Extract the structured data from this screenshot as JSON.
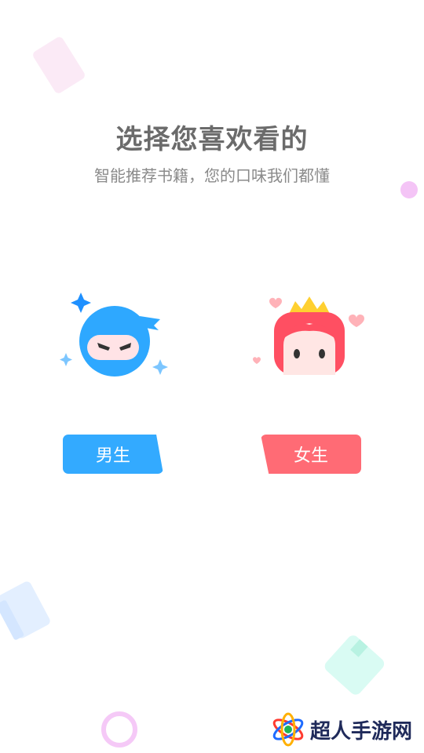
{
  "header": {
    "title": "选择您喜欢看的",
    "subtitle": "智能推荐书籍，您的口味我们都懂"
  },
  "options": {
    "male": {
      "label": "男生",
      "avatar_icon": "ninja-boy-icon",
      "color": "#33aaff"
    },
    "female": {
      "label": "女生",
      "avatar_icon": "princess-girl-icon",
      "color": "#ff6b75"
    }
  },
  "watermark": {
    "text": "超人手游网",
    "icon": "atom-logo-icon"
  }
}
